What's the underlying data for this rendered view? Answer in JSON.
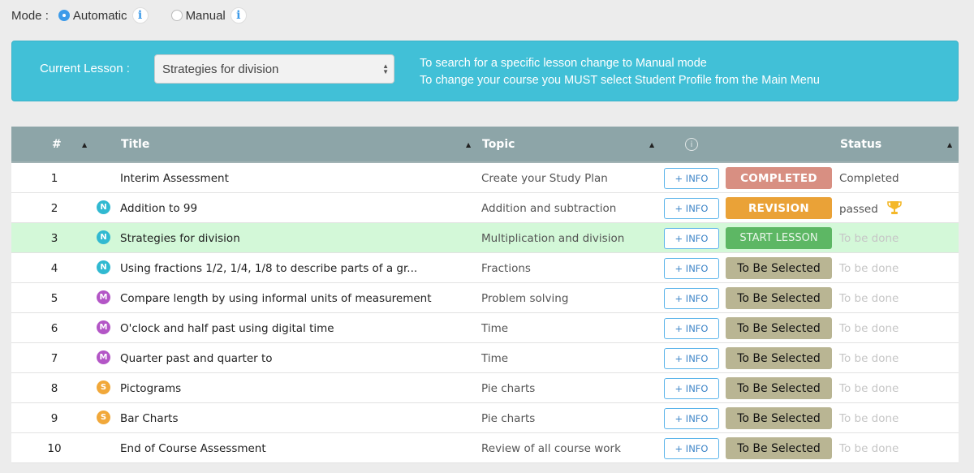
{
  "mode": {
    "label": "Mode :",
    "options": [
      {
        "label": "Automatic",
        "selected": true,
        "info_icon": "info-icon"
      },
      {
        "label": "Manual",
        "selected": false,
        "info_icon": "info-icon"
      }
    ]
  },
  "lesson_panel": {
    "label": "Current Lesson :",
    "selected_lesson": "Strategies for division",
    "help_lines": [
      "To search for a specific lesson change to Manual mode",
      "To change your course you MUST select Student Profile from the Main Menu"
    ],
    "background": "#41c0d7"
  },
  "table": {
    "columns": {
      "num": "#",
      "title": "Title",
      "topic": "Topic",
      "info": "i",
      "status": "Status"
    },
    "info_button_label": "+ INFO",
    "badge_colors": {
      "N": "#31b9d1",
      "M": "#b356c6",
      "S": "#f1a83a"
    },
    "rows": [
      {
        "num": "1",
        "badge": "",
        "title": "Interim Assessment",
        "topic": "Create your Study Plan",
        "action": "COMPLETED",
        "action_type": "completed",
        "status": "Completed",
        "status_type": "done",
        "trophy": false,
        "current": false
      },
      {
        "num": "2",
        "badge": "N",
        "title": "Addition to 99",
        "topic": "Addition and subtraction",
        "action": "REVISION",
        "action_type": "revision",
        "status": "passed",
        "status_type": "done",
        "trophy": true,
        "current": false
      },
      {
        "num": "3",
        "badge": "N",
        "title": "Strategies for division",
        "topic": "Multiplication and division",
        "action": "START LESSON",
        "action_type": "start",
        "status": "To be done",
        "status_type": "todo",
        "trophy": false,
        "current": true
      },
      {
        "num": "4",
        "badge": "N",
        "title": "Using fractions 1/2, 1/4, 1/8 to describe parts of a gr...",
        "topic": "Fractions",
        "action": "To Be Selected",
        "action_type": "select",
        "status": "To be done",
        "status_type": "todo",
        "trophy": false,
        "current": false
      },
      {
        "num": "5",
        "badge": "M",
        "title": "Compare length by using informal units of measurement",
        "topic": "Problem solving",
        "action": "To Be Selected",
        "action_type": "select",
        "status": "To be done",
        "status_type": "todo",
        "trophy": false,
        "current": false
      },
      {
        "num": "6",
        "badge": "M",
        "title": "O'clock and half past using digital time",
        "topic": "Time",
        "action": "To Be Selected",
        "action_type": "select",
        "status": "To be done",
        "status_type": "todo",
        "trophy": false,
        "current": false
      },
      {
        "num": "7",
        "badge": "M",
        "title": "Quarter past and quarter to",
        "topic": "Time",
        "action": "To Be Selected",
        "action_type": "select",
        "status": "To be done",
        "status_type": "todo",
        "trophy": false,
        "current": false
      },
      {
        "num": "8",
        "badge": "S",
        "title": "Pictograms",
        "topic": "Pie charts",
        "action": "To Be Selected",
        "action_type": "select",
        "status": "To be done",
        "status_type": "todo",
        "trophy": false,
        "current": false
      },
      {
        "num": "9",
        "badge": "S",
        "title": "Bar Charts",
        "topic": "Pie charts",
        "action": "To Be Selected",
        "action_type": "select",
        "status": "To be done",
        "status_type": "todo",
        "trophy": false,
        "current": false
      },
      {
        "num": "10",
        "badge": "",
        "title": "End of Course Assessment",
        "topic": "Review of all course work",
        "action": "To Be Selected",
        "action_type": "select",
        "status": "To be done",
        "status_type": "todo",
        "trophy": false,
        "current": false
      }
    ]
  }
}
